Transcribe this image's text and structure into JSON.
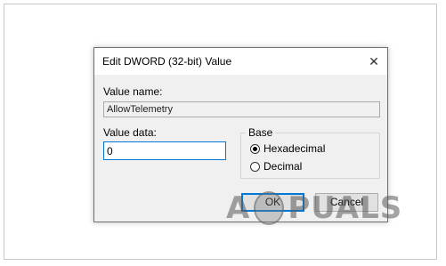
{
  "dialog": {
    "title": "Edit DWORD (32-bit) Value",
    "close_symbol": "✕",
    "value_name_label": "Value name:",
    "value_name": "AllowTelemetry",
    "value_data_label": "Value data:",
    "value_data": "0",
    "base_label": "Base",
    "base_options": [
      {
        "label": "Hexadecimal",
        "checked": true
      },
      {
        "label": "Decimal",
        "checked": false
      }
    ],
    "ok_label": "OK",
    "cancel_label": "Cancel"
  },
  "watermark": {
    "text_left": "A",
    "text_right": "PUALS",
    "mascot_icon": "appuals-mascot-icon"
  },
  "colors": {
    "accent": "#0078d7",
    "dialog_bg": "#f0f0f0"
  }
}
